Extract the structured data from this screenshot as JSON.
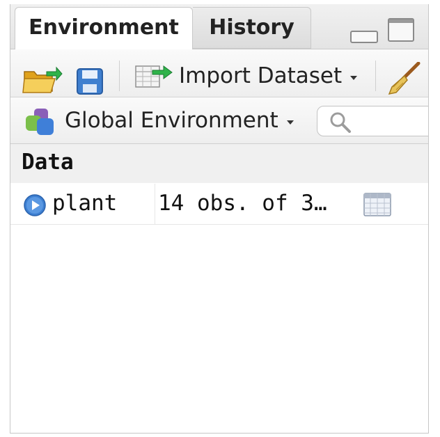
{
  "tabs": [
    {
      "label": "Environment",
      "active": true
    },
    {
      "label": "History",
      "active": false
    }
  ],
  "toolbar": {
    "load_icon": "open-folder-icon",
    "save_icon": "save-icon",
    "import_dataset_label": "Import Dataset",
    "clear_icon": "broom-icon"
  },
  "environment_bar": {
    "selected_environment": "Global Environment",
    "search_placeholder": ""
  },
  "section": {
    "title": "Data"
  },
  "rows": [
    {
      "name": "plant",
      "value": "14 obs. of 3…",
      "icon": "table-grid-icon"
    }
  ],
  "colors": {
    "accent_blue": "#3d7fd1",
    "pane_border": "#c7c7c7"
  }
}
